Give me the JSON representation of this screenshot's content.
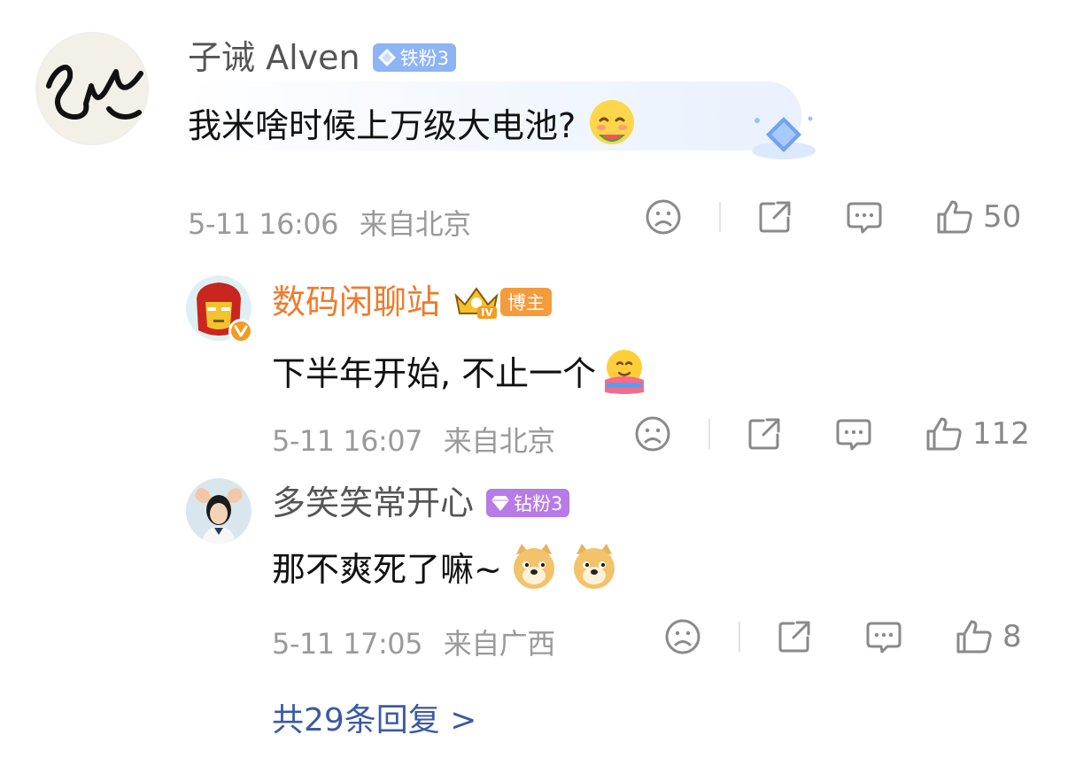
{
  "comments": [
    {
      "username": "子诫 Alven",
      "badge": "铁粉3",
      "text": "我米啥时候上万级大电池?",
      "time": "5-11 16:06",
      "location": "来自北京",
      "likes": "50",
      "badge_color": "#7fa8f0",
      "icons": [
        "dislike-face-icon",
        "share-icon",
        "comment-icon",
        "like-thumb-icon"
      ]
    },
    {
      "username": "数码闲聊站",
      "crown_level": "IV",
      "badge": "博主",
      "text": "下半年开始, 不止一个",
      "time": "5-11 16:07",
      "location": "来自北京",
      "likes": "112",
      "username_color": "#f07a2a",
      "badge_color": "#f39a3b"
    },
    {
      "username": "多笑笑常开心",
      "badge": "钻粉3",
      "text": "那不爽死了嘛~",
      "time": "5-11 17:05",
      "location": "来自广西",
      "likes": "8",
      "badge_color": "#b77be8"
    }
  ],
  "replies_link": "共29条回复 >",
  "colors": {
    "meta_gray": "#9a9a9a",
    "link_blue": "#3b5aa3"
  }
}
